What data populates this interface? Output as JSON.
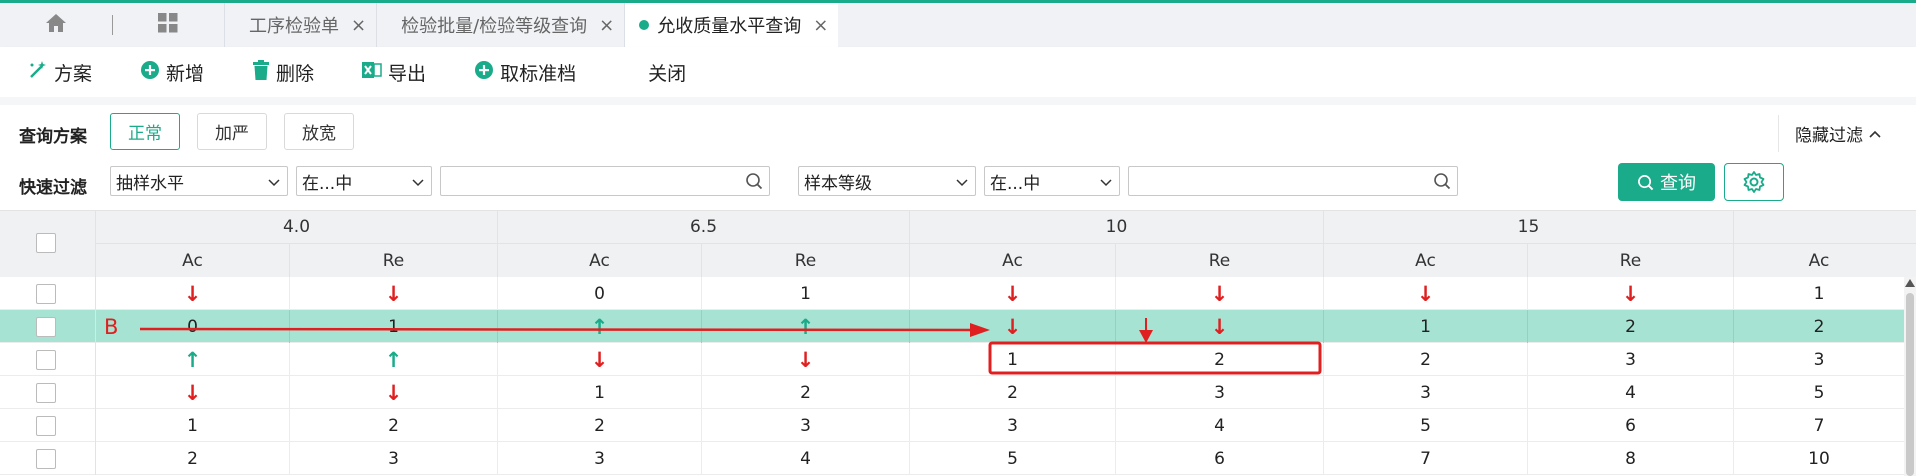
{
  "tabs": {
    "home_icon": "home-icon",
    "grid_icon": "grid-icon",
    "items": [
      {
        "label": "工序检验单",
        "close": "×"
      },
      {
        "label": "检验批量/检验等级查询",
        "close": "×"
      },
      {
        "label": "允收质量水平查询",
        "close": "×"
      }
    ],
    "active_index": 2
  },
  "toolbar": {
    "scheme": "方案",
    "add": "新增",
    "delete": "删除",
    "export": "导出",
    "cancel_archive": "取标准档",
    "close": "关闭"
  },
  "filter": {
    "scheme_label": "查询方案",
    "schemes": [
      "正常",
      "加严",
      "放宽"
    ],
    "active_scheme": "正常",
    "hide_filter": "隐藏过滤",
    "quick_label": "快速过滤",
    "field1": "抽样水平",
    "op1": "在...中",
    "value1": "",
    "field2": "样本等级",
    "op2": "在...中",
    "value2": "",
    "query": "查询"
  },
  "grid": {
    "groups": [
      "4.0",
      "6.5",
      "10",
      "15"
    ],
    "sub_headers": [
      "Ac",
      "Re",
      "Ac",
      "Re",
      "Ac",
      "Re",
      "Ac",
      "Re",
      "Ac"
    ],
    "rows": [
      [
        "↓",
        "↓",
        "0",
        "1",
        "↓",
        "↓",
        "↓",
        "↓",
        "1"
      ],
      [
        "0",
        "1",
        "↑",
        "↑",
        "↓",
        "↓",
        "1",
        "2",
        "2"
      ],
      [
        "↑",
        "↑",
        "↓",
        "↓",
        "1",
        "2",
        "2",
        "3",
        "3"
      ],
      [
        "↓",
        "↓",
        "1",
        "2",
        "2",
        "3",
        "3",
        "4",
        "5"
      ],
      [
        "1",
        "2",
        "2",
        "3",
        "3",
        "4",
        "5",
        "6",
        "7"
      ],
      [
        "2",
        "3",
        "3",
        "4",
        "5",
        "6",
        "7",
        "8",
        "10"
      ]
    ],
    "selected_row": 1,
    "row_marker": "B"
  },
  "colors": {
    "accent": "#1aab8a",
    "selected_row": "#a6e3d3",
    "arrow_down": "#e02020",
    "arrow_up": "#1aab8a",
    "annotation": "#e02020"
  }
}
